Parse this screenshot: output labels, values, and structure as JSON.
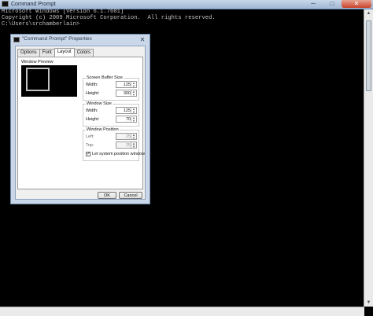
{
  "window": {
    "title": "Command Prompt",
    "min_glyph": "─",
    "max_glyph": "□",
    "close_glyph": "✕"
  },
  "console": {
    "lines": [
      "Microsoft Windows [Version 6.1.7601]",
      "Copyright (c) 2009 Microsoft Corporation.  All rights reserved.",
      "",
      "C:\\Users\\srchamberlain>"
    ]
  },
  "dialog": {
    "title": "\"Command Prompt\" Properties",
    "close_glyph": "✕",
    "tabs": [
      {
        "label": "Options"
      },
      {
        "label": "Font"
      },
      {
        "label": "Layout"
      },
      {
        "label": "Colors"
      }
    ],
    "active_tab": "Layout",
    "preview_label": "Window Preview",
    "buffer": {
      "title": "Screen Buffer Size",
      "width_label": "Width:",
      "width_value": "125",
      "height_label": "Height:",
      "height_value": "300"
    },
    "window_size": {
      "title": "Window Size",
      "width_label": "Width:",
      "width_value": "125",
      "height_label": "Height:",
      "height_value": "70"
    },
    "window_position": {
      "title": "Window Position",
      "left_label": "Left:",
      "left_value": "25",
      "top_label": "Top:",
      "top_value": "25",
      "system_checkbox_label": "Let system position window",
      "system_checkbox_checked": true
    },
    "ok_label": "OK",
    "cancel_label": "Cancel"
  }
}
